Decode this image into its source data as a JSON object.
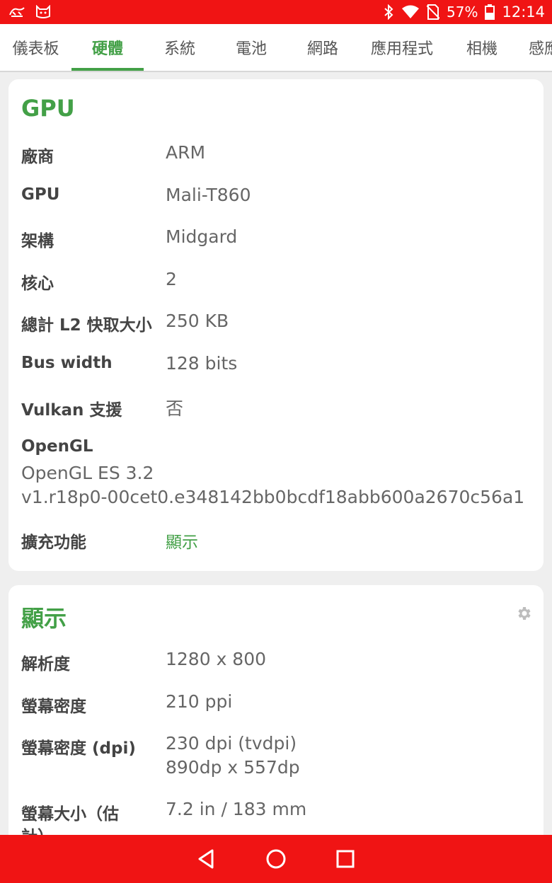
{
  "status_bar": {
    "battery_percent": "57%",
    "time": "12:14",
    "icons": [
      "app-notification-icon",
      "cat-face-icon",
      "bluetooth-icon",
      "wifi-icon",
      "no-sim-icon",
      "battery-icon"
    ]
  },
  "tabs": [
    {
      "label": "儀表板"
    },
    {
      "label": "硬體"
    },
    {
      "label": "系統"
    },
    {
      "label": "電池"
    },
    {
      "label": "網路"
    },
    {
      "label": "應用程式"
    },
    {
      "label": "相機"
    },
    {
      "label": "感應"
    }
  ],
  "active_tab": 1,
  "gpu_card": {
    "title": "GPU",
    "rows": [
      {
        "label": "廠商",
        "value": "ARM"
      },
      {
        "label": "GPU",
        "value": "Mali-T860"
      },
      {
        "label": "架構",
        "value": "Midgard"
      },
      {
        "label": "核心",
        "value": "2"
      },
      {
        "label": "總計 L2 快取大小",
        "value": "250 KB"
      },
      {
        "label": "Bus width",
        "value": "128 bits"
      },
      {
        "label": "Vulkan 支援",
        "value": "否"
      }
    ],
    "opengl_label": "OpenGL",
    "opengl_line1": "OpenGL ES 3.2",
    "opengl_line2": "v1.r18p0-00cet0.e348142bb0bcdf18abb600a2670c56a1",
    "extensions_label": "擴充功能",
    "extensions_link": "顯示"
  },
  "display_card": {
    "title": "顯示",
    "rows": [
      {
        "label": "解析度",
        "value": "1280 x 800"
      },
      {
        "label": "螢幕密度",
        "value": "210 ppi"
      },
      {
        "label": "螢幕密度 (dpi)",
        "value": "230 dpi (tvdpi)",
        "value2": "890dp x 557dp"
      },
      {
        "label": "螢幕大小（估",
        "label2": "計）",
        "value": "7.2 in / 183 mm"
      }
    ]
  },
  "colors": {
    "status_bar": "#f01414",
    "accent": "#43a047"
  }
}
